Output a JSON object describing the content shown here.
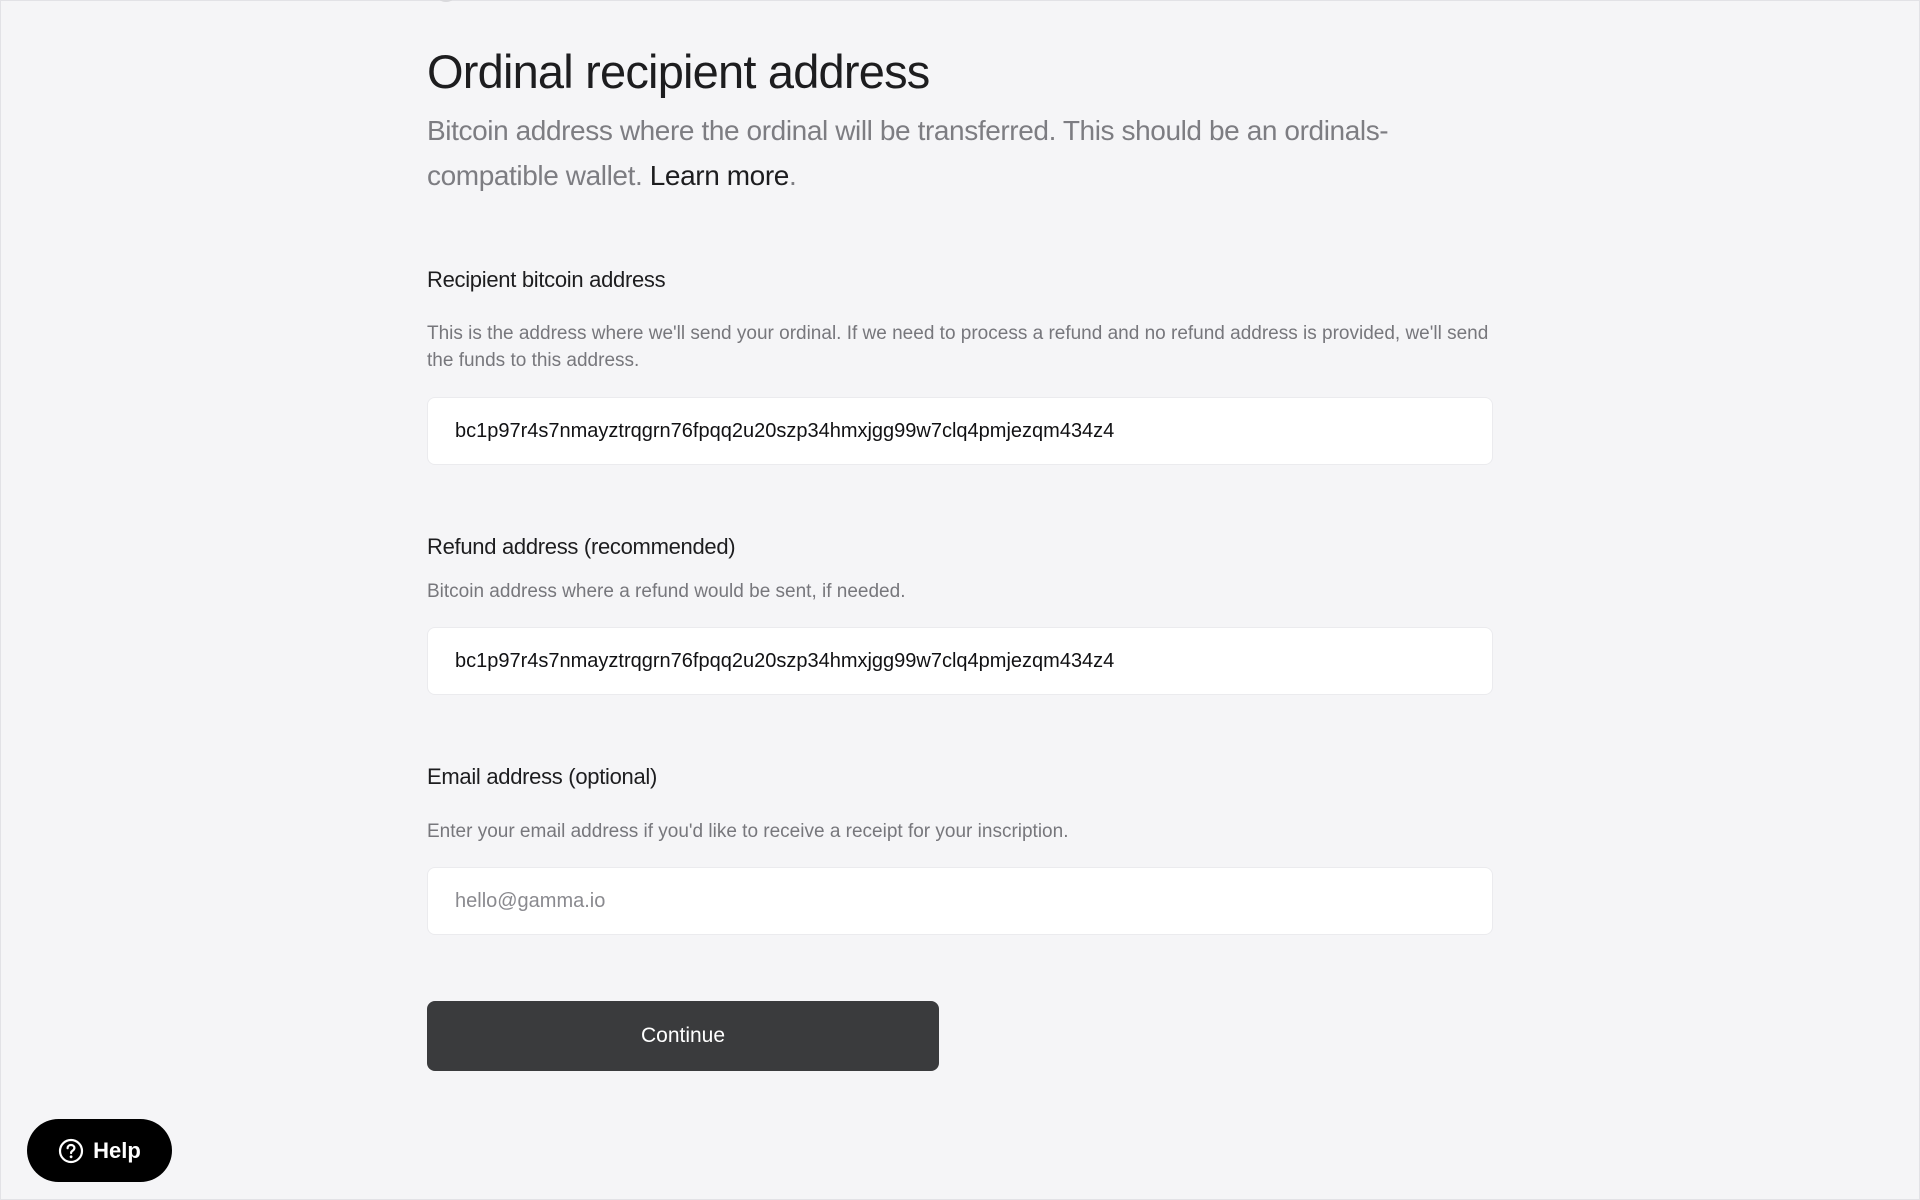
{
  "header": {
    "title": "Ordinal recipient address",
    "subtitle_text": "Bitcoin address where the ordinal will be transferred. This should be an ordinals-compatible wallet.",
    "learn_more_label": "Learn more",
    "subtitle_end": "."
  },
  "fields": {
    "recipient": {
      "label": "Recipient bitcoin address",
      "help": "This is the address where we'll send your ordinal. If we need to process a refund and no refund address is provided, we'll send the funds to this address.",
      "value": "bc1p97r4s7nmayztrqgrn76fpqq2u20szp34hmxjgg99w7clq4pmjezqm434z4"
    },
    "refund": {
      "label": "Refund address (recommended)",
      "help": "Bitcoin address where a refund would be sent, if needed.",
      "value": "bc1p97r4s7nmayztrqgrn76fpqq2u20szp34hmxjgg99w7clq4pmjezqm434z4"
    },
    "email": {
      "label": "Email address (optional)",
      "help": "Enter your email address if you'd like to receive a receipt for your inscription.",
      "value": "",
      "placeholder": "hello@gamma.io"
    }
  },
  "actions": {
    "continue_label": "Continue",
    "help_label": "Help",
    "help_icon": "question-circle-icon"
  },
  "colors": {
    "background": "#f5f5f7",
    "button": "#3a3b3d",
    "help_button": "#000000"
  }
}
